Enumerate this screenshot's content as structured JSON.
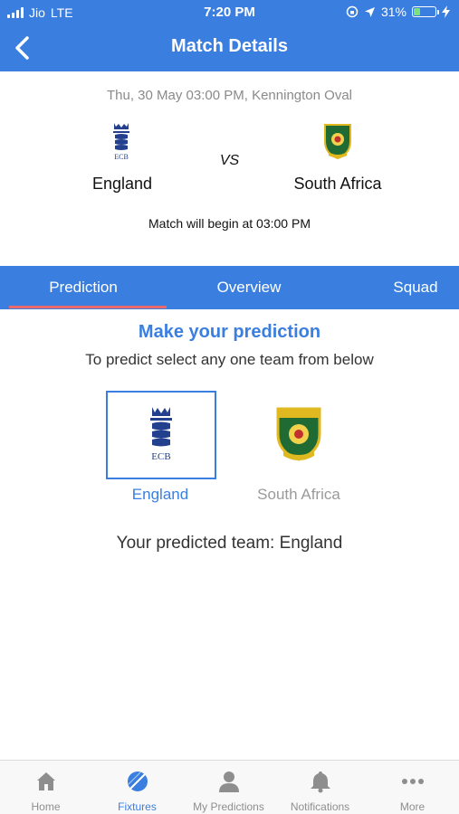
{
  "status_bar": {
    "carrier": "Jio",
    "network": "LTE",
    "time": "7:20 PM",
    "battery": "31%",
    "battery_level": 0.31
  },
  "header": {
    "title": "Match Details",
    "back_icon": "chevron-left-icon"
  },
  "match": {
    "date_venue": "Thu, 30 May 03:00 PM, Kennington Oval",
    "team1": {
      "name": "England",
      "logo": "ecb-logo-icon",
      "logo_text": "ECB"
    },
    "team2": {
      "name": "South Africa",
      "logo": "protea-crest-icon"
    },
    "vs": "VS",
    "begin_text": "Match will begin at 03:00 PM"
  },
  "tabs": [
    {
      "label": "Prediction",
      "active": true
    },
    {
      "label": "Overview",
      "active": false
    },
    {
      "label": "Squad",
      "active": false
    }
  ],
  "prediction": {
    "heading": "Make your prediction",
    "subheading": "To predict select any one team from below",
    "options": [
      {
        "label": "England",
        "selected": true
      },
      {
        "label": "South Africa",
        "selected": false
      }
    ],
    "result": "Your predicted team: England"
  },
  "bottom_nav": [
    {
      "label": "Home",
      "icon": "home-icon",
      "active": false
    },
    {
      "label": "Fixtures",
      "icon": "cricket-ball-icon",
      "active": true
    },
    {
      "label": "My Predictions",
      "icon": "user-icon",
      "active": false
    },
    {
      "label": "Notifications",
      "icon": "bell-icon",
      "active": false
    },
    {
      "label": "More",
      "icon": "more-dots-icon",
      "active": false
    }
  ],
  "colors": {
    "primary": "#3a7fe0",
    "tab_indicator": "#e86a6a",
    "inactive": "#8e8e8e"
  }
}
